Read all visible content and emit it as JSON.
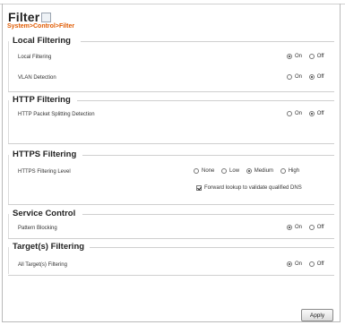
{
  "page": {
    "title": "Filter",
    "breadcrumb": "System>Control>Filter"
  },
  "sections": {
    "local": {
      "title": "Local Filtering",
      "rows": [
        {
          "label": "Local Filtering",
          "options": [
            "On",
            "Off"
          ],
          "selected": "On"
        },
        {
          "label": "VLAN Detection",
          "options": [
            "On",
            "Off"
          ],
          "selected": "Off"
        }
      ]
    },
    "http": {
      "title": "HTTP Filtering",
      "rows": [
        {
          "label": "HTTP Packet Splitting Detection",
          "options": [
            "On",
            "Off"
          ],
          "selected": "Off"
        }
      ]
    },
    "https": {
      "title": "HTTPS Filtering",
      "rows": [
        {
          "label": "HTTPS Filtering Level",
          "options": [
            "None",
            "Low",
            "Medium",
            "High"
          ],
          "selected": "Medium"
        }
      ],
      "checkbox": {
        "label": "Forward lookup to validate qualified DNS",
        "checked": true
      }
    },
    "service": {
      "title": "Service Control",
      "rows": [
        {
          "label": "Pattern Blocking",
          "options": [
            "On",
            "Off"
          ],
          "selected": "On"
        }
      ]
    },
    "targets": {
      "title": "Target(s) Filtering",
      "rows": [
        {
          "label": "All Target(s) Filtering",
          "options": [
            "On",
            "Off"
          ],
          "selected": "On"
        }
      ]
    }
  },
  "buttons": {
    "apply": "Apply"
  }
}
